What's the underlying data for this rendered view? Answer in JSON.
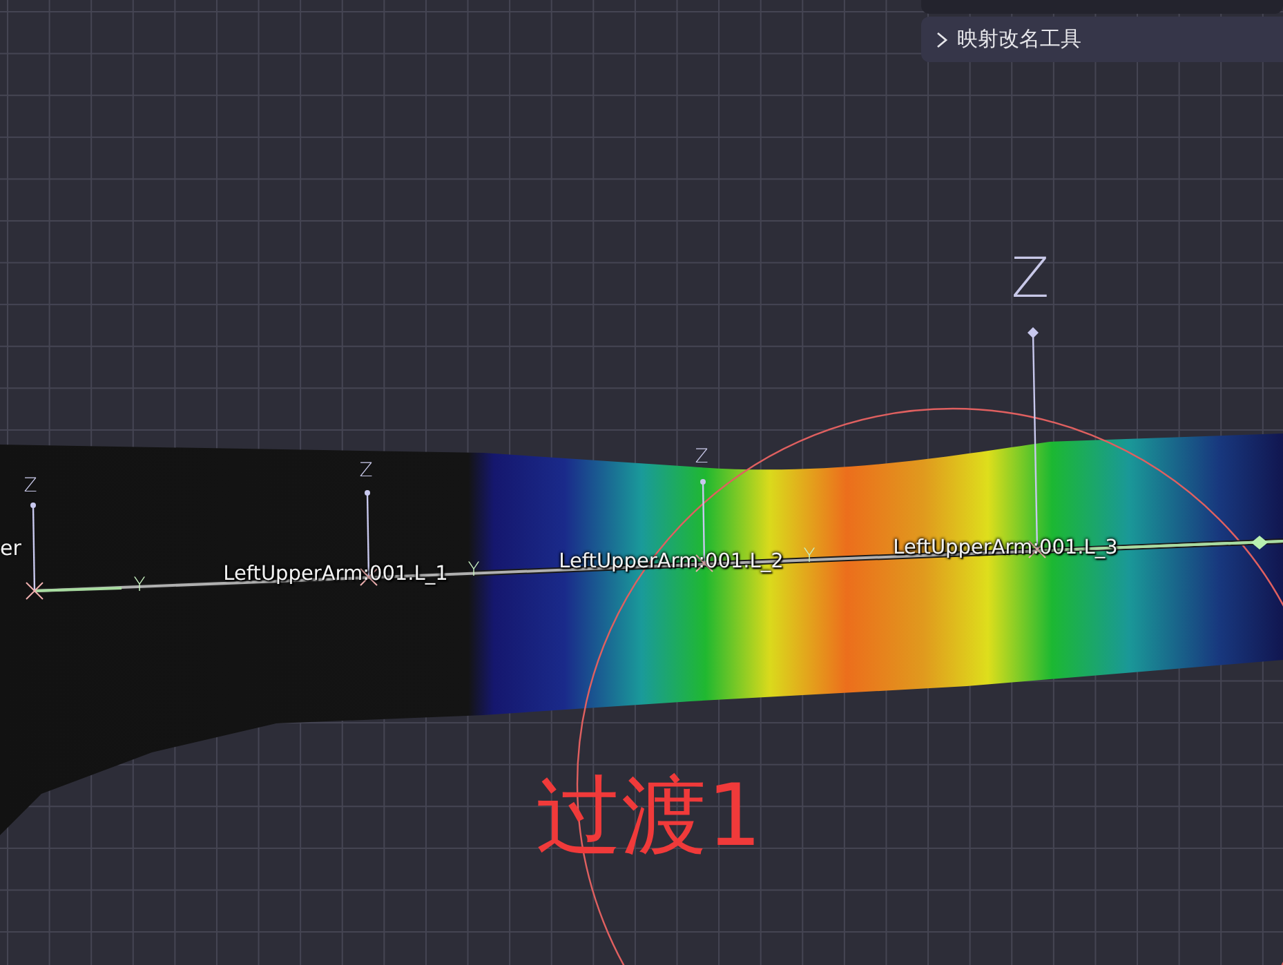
{
  "panel": {
    "title": "映射改名工具",
    "expanded": false
  },
  "partial_bone_label": "er",
  "bones": [
    {
      "name": "LeftUpperArm:001.L_1"
    },
    {
      "name": "LeftUpperArm:001.L_2"
    },
    {
      "name": "LeftUpperArm:001.L_3"
    }
  ],
  "axis_labels": [
    {
      "text": "Z",
      "kind": "small"
    },
    {
      "text": "Y",
      "kind": "small"
    },
    {
      "text": "Z",
      "kind": "small"
    },
    {
      "text": "Y",
      "kind": "small"
    },
    {
      "text": "Z",
      "kind": "small"
    },
    {
      "text": "Y",
      "kind": "small"
    },
    {
      "text": "Z",
      "kind": "large"
    }
  ],
  "overlay_text": "过渡1"
}
